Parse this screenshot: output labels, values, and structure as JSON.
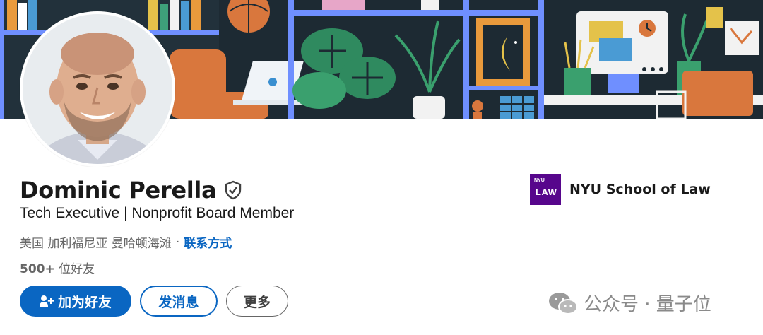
{
  "profile": {
    "name": "Dominic Perella",
    "headline": "Tech Executive | Nonprofit Board Member",
    "location": "美国 加利福尼亚 曼哈顿海滩",
    "location_separator": "·",
    "contact_label": "联系方式",
    "connections_count": "500+",
    "connections_label": "位好友"
  },
  "actions": {
    "connect_label": "加为好友",
    "message_label": "发消息",
    "more_label": "更多"
  },
  "education": {
    "school_name": "NYU School of Law",
    "logo_top": "NYU",
    "logo_text": "LAW"
  },
  "watermark": {
    "text": "公众号 · 量子位"
  },
  "icons": {
    "verify": "shield-check-icon",
    "connect": "add-user-icon",
    "watermark": "wechat-icon"
  },
  "colors": {
    "primary": "#0a66c2",
    "school": "#57068c",
    "banner_bg": "#1d2a33"
  }
}
